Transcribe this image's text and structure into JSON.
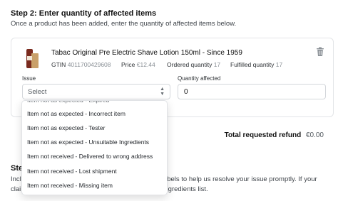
{
  "step2": {
    "title": "Step 2: Enter quantity of affected items",
    "description": "Once a product has been added, enter the quantity of affected items below."
  },
  "product": {
    "name": "Tabac Original Pre Electric Shave Lotion 150ml - Since 1959",
    "gtin_label": "GTIN",
    "gtin": "4011700429608",
    "price_label": "Price",
    "price": "€12.44",
    "ordered_label": "Ordered quantity",
    "ordered": "17",
    "fulfilled_label": "Fulfilled quantity",
    "fulfilled": "17"
  },
  "form": {
    "issue_label": "Issue",
    "issue_value": "Select",
    "qty_label": "Quantity affected",
    "qty_value": "0"
  },
  "dropdown": {
    "cut_item": "Item not as expected - Expired",
    "items": [
      "Item not as expected - Incorrect item",
      "Item not as expected - Tester",
      "Item not as expected - Unsuitable Ingredients",
      "Item not received - Delivered to wrong address",
      "Item not received - Lost shipment",
      "Item not received - Missing item"
    ]
  },
  "refund": {
    "label": "Total requested refund",
    "value": "€0.00"
  },
  "step3": {
    "title_visible": "Ste",
    "line1_visible": "Incl",
    "line1_tail": "labels to help us resolve your issue promptly. If your",
    "line2_visible": "clai",
    "line2_tail": "ingredients list."
  }
}
